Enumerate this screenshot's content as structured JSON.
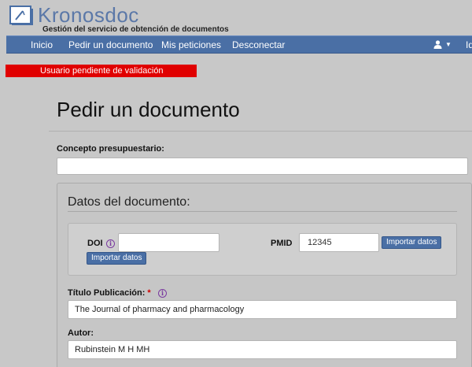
{
  "brand": {
    "title": "Kronosdoc",
    "subtitle": "Gestión del servicio de obtención de documentos",
    "logo_icon": "book-clock-icon",
    "accent_color": "#5b78a8"
  },
  "navbar": {
    "background": "#4a6fa5",
    "items": [
      {
        "label": "Inicio"
      },
      {
        "label": "Pedir un documento"
      },
      {
        "label": "Mis peticiones"
      },
      {
        "label": "Desconectar"
      }
    ],
    "user_icon": "user-icon",
    "lang_label": "Id"
  },
  "alert": {
    "text": "Usuario pendiente de validación",
    "color": "#e00000"
  },
  "page": {
    "title": "Pedir un documento"
  },
  "form": {
    "concept_label": "Concepto presupuestario:",
    "concept_value": "",
    "panel_title": "Datos del documento:",
    "doi": {
      "label": "DOI",
      "value": "",
      "button": "Importar datos"
    },
    "pmid": {
      "label": "PMID",
      "value": "12345",
      "button": "Importar datos"
    },
    "titulo": {
      "label": "Título Publicación:",
      "required_mark": "*",
      "value": "The Journal of pharmacy and pharmacology"
    },
    "autor": {
      "label": "Autor:",
      "value": "Rubinstein M H MH"
    },
    "info_icon_glyph": "i"
  }
}
